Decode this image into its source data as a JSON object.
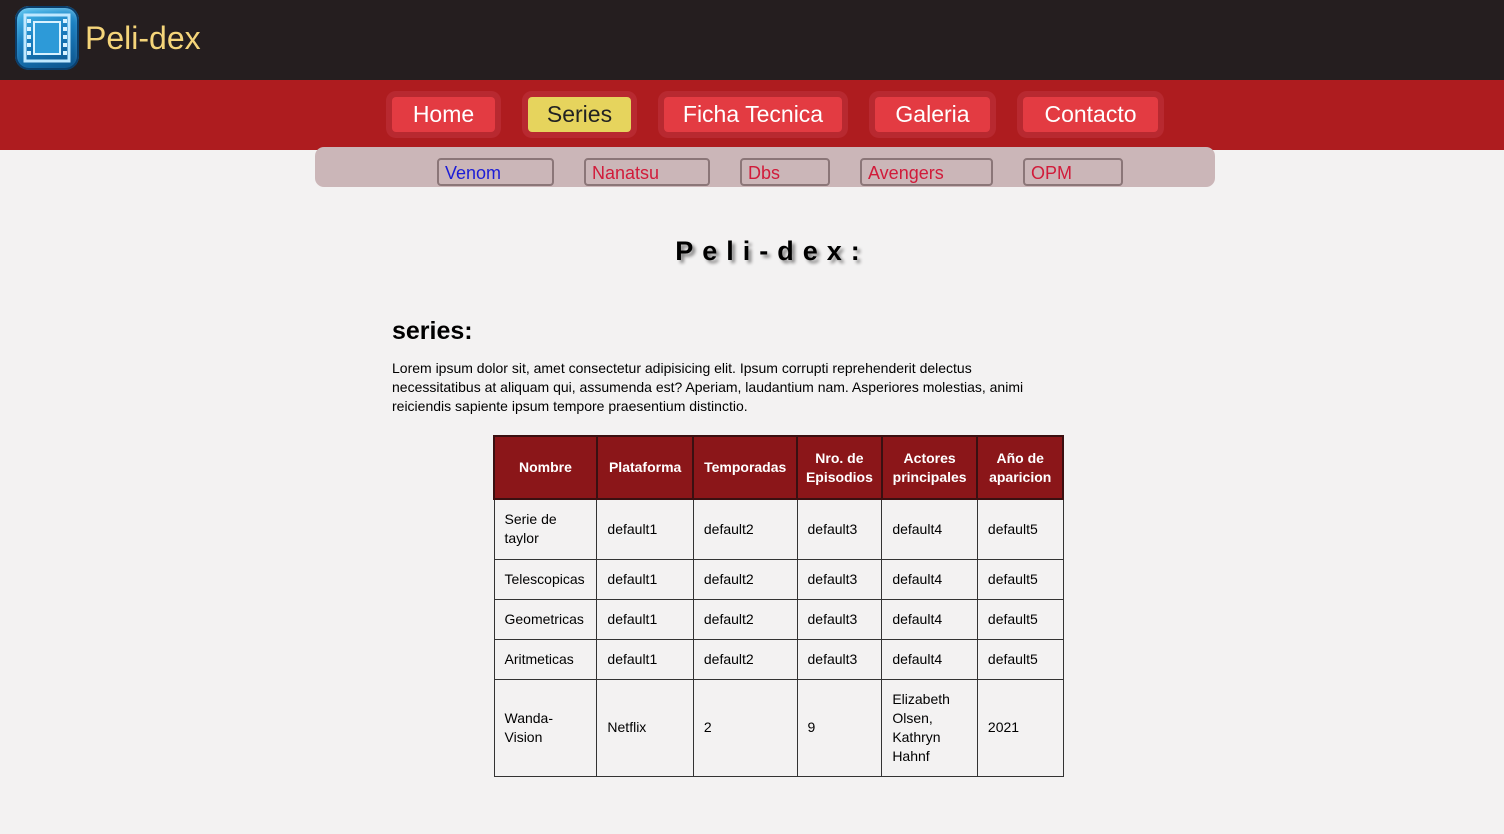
{
  "brand": {
    "name": "Peli-dex",
    "icon": "film-icon"
  },
  "nav": {
    "items": [
      "Home",
      "Series",
      "Ficha Tecnica",
      "Galeria",
      "Contacto"
    ],
    "active": "Series"
  },
  "subnav": {
    "items": [
      "Venom",
      "Nanatsu",
      "Dbs",
      "Avengers",
      "OPM"
    ]
  },
  "main": {
    "title": "Peli-dex:",
    "section_title": "series:",
    "description": "Lorem ipsum dolor sit, amet consectetur adipisicing elit. Ipsum corrupti reprehenderit delectus necessitatibus at aliquam qui, assumenda est? Aperiam, laudantium nam. Asperiores molestias, animi reiciendis sapiente ipsum tempore praesentium distinctio."
  },
  "table": {
    "headers": [
      "Nombre",
      "Plataforma",
      "Temporadas",
      "Nro. de Episodios",
      "Actores principales",
      "Año de aparicion"
    ],
    "rows": [
      [
        "Serie de taylor",
        "default1",
        "default2",
        "default3",
        "default4",
        "default5"
      ],
      [
        "Telescopicas",
        "default1",
        "default2",
        "default3",
        "default4",
        "default5"
      ],
      [
        "Geometricas",
        "default1",
        "default2",
        "default3",
        "default4",
        "default5"
      ],
      [
        "Aritmeticas",
        "default1",
        "default2",
        "default3",
        "default4",
        "default5"
      ],
      [
        "Wanda-Vision",
        "Netflix",
        "2",
        "9",
        "Elizabeth Olsen, Kathryn Hahnf",
        "2021"
      ]
    ]
  },
  "colors": {
    "topbar": "#251e1f",
    "navbar": "#ae1c1f",
    "nav_button": "#e33b42",
    "nav_active": "#e6d45d",
    "subnav": "#cbb6b8",
    "table_header": "#8b1619",
    "brand_text": "#f5d57a"
  }
}
